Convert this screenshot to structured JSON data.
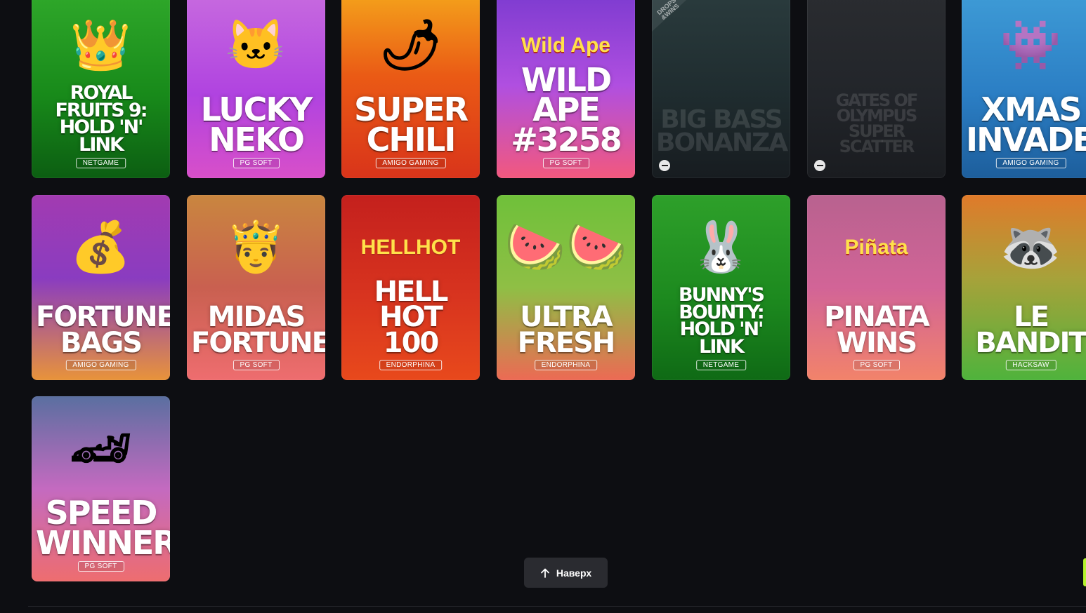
{
  "games": [
    {
      "title": "ROYAL FRUITS 9:\nHOLD 'N' LINK",
      "provider": "NETGAME",
      "bg": "linear-gradient(180deg,#2fa82a 0%,#188a1a 55%,#0c5e12 100%)",
      "icon": "crown-icon",
      "art": "👑",
      "size": 27,
      "dim": false
    },
    {
      "title": "LUCKY\nNEKO",
      "provider": "PG SOFT",
      "bg": "linear-gradient(180deg,#c76adf 0%,#b043e0 55%,#d84fc9 100%)",
      "icon": "lucky-cat-icon",
      "art": "🐱",
      "size": 46,
      "dim": false
    },
    {
      "title": "SUPER\nCHILI",
      "provider": "AMIGO GAMING",
      "bg": "linear-gradient(180deg,#f4a21b 0%,#ea5a15 45%,#d9341a 100%)",
      "icon": "chili-pepper-icon",
      "art": "🌶",
      "size": 46,
      "dim": false
    },
    {
      "title": "WILD APE\n#3258",
      "provider": "PG SOFT",
      "bg": "linear-gradient(180deg,#7d3bd0 0%,#b04fe0 50%,#f2587e 100%)",
      "icon": "wild-ape-logo-icon",
      "art": "Wild Ape",
      "size": 46,
      "dim": false
    },
    {
      "title": "BIG BASS\nBONANZA",
      "provider": "",
      "bg": "linear-gradient(180deg,#2a3b3d 0%,#1f2c2f 55%,#171c20 100%)",
      "icon": "fisherman-icon",
      "art": "",
      "size": 36,
      "dim": true
    },
    {
      "title": "GATES OF\nOLYMPUS\nSUPER SCATTER",
      "provider": "",
      "bg": "linear-gradient(180deg,#2a2c30 0%,#22252a 55%,#1a1c20 100%)",
      "icon": "zeus-icon",
      "art": "",
      "size": 24,
      "dim": true
    },
    {
      "title": "XMAS\nINVADERS",
      "provider": "AMIGO GAMING",
      "bg": "linear-gradient(180deg,#3e9bd6 0%,#2b7ec4 55%,#1d5e9c 100%)",
      "icon": "alien-monster-icon",
      "art": "👾",
      "size": 46,
      "dim": false
    },
    {
      "title": "FORTUNE\nBAGS",
      "provider": "AMIGO GAMING",
      "bg": "linear-gradient(180deg,#a23bb1 0%,#8a3cc0 45%,#e8933a 100%)",
      "icon": "coin-bag-icon",
      "art": "💰",
      "size": 40,
      "dim": false
    },
    {
      "title": "MIDAS\nFORTUNE",
      "provider": "PG SOFT",
      "bg": "linear-gradient(180deg,#c9863f 0%,#c96050 50%,#ee6d6f 100%)",
      "icon": "king-midas-icon",
      "art": "🤴",
      "size": 40,
      "dim": false
    },
    {
      "title": "HELL HOT\n100",
      "provider": "ENDORPHINA",
      "bg": "linear-gradient(180deg,#c4201d 0%,#d8341f 55%,#e8491c 100%)",
      "icon": "hellhot-logo-icon",
      "art": "HELLHOT",
      "size": 40,
      "dim": false
    },
    {
      "title": "ULTRA\nFRESH",
      "provider": "ENDORPHINA",
      "bg": "linear-gradient(180deg,#6fc03a 0%,#8fbf45 50%,#ec6a54 100%)",
      "icon": "watermelon-icon",
      "art": "🍉🍉",
      "size": 40,
      "dim": false
    },
    {
      "title": "BUNNY'S BOUNTY:\nHOLD 'N' LINK",
      "provider": "NETGAME",
      "bg": "linear-gradient(180deg,#2ea02a 0%,#1d8a1f 55%,#0f6a15 100%)",
      "icon": "bunny-icon",
      "art": "🐰",
      "size": 27,
      "dim": false
    },
    {
      "title": "PINATA\nWINS",
      "provider": "PG SOFT",
      "bg": "linear-gradient(180deg,#b8628f 0%,#d26497 50%,#f2836a 100%)",
      "icon": "pinata-logo-icon",
      "art": "Piñata",
      "size": 40,
      "dim": false
    },
    {
      "title": "LE BANDIT",
      "provider": "HACKSAW",
      "bg": "linear-gradient(180deg,#e07a2a 0%,#a7a23a 45%,#4fb33c 100%)",
      "icon": "raccoon-bandit-icon",
      "art": "🦝",
      "size": 40,
      "dim": false
    },
    {
      "title": "SPEED\nWINNER",
      "provider": "PG SOFT",
      "bg": "linear-gradient(180deg,#5a6fa0 0%,#c46ac0 50%,#ee6d6f 100%)",
      "icon": "race-car-icon",
      "art": "🏎",
      "size": 46,
      "dim": false
    }
  ],
  "drops_badge": "DROPS\n&WINS",
  "back_to_top": {
    "label": "Наверх",
    "icon": "arrow-up-icon"
  },
  "colors": {
    "page_bg": "#0d0e12",
    "button_bg": "#2a2b30",
    "accent": "#b6f22e"
  }
}
